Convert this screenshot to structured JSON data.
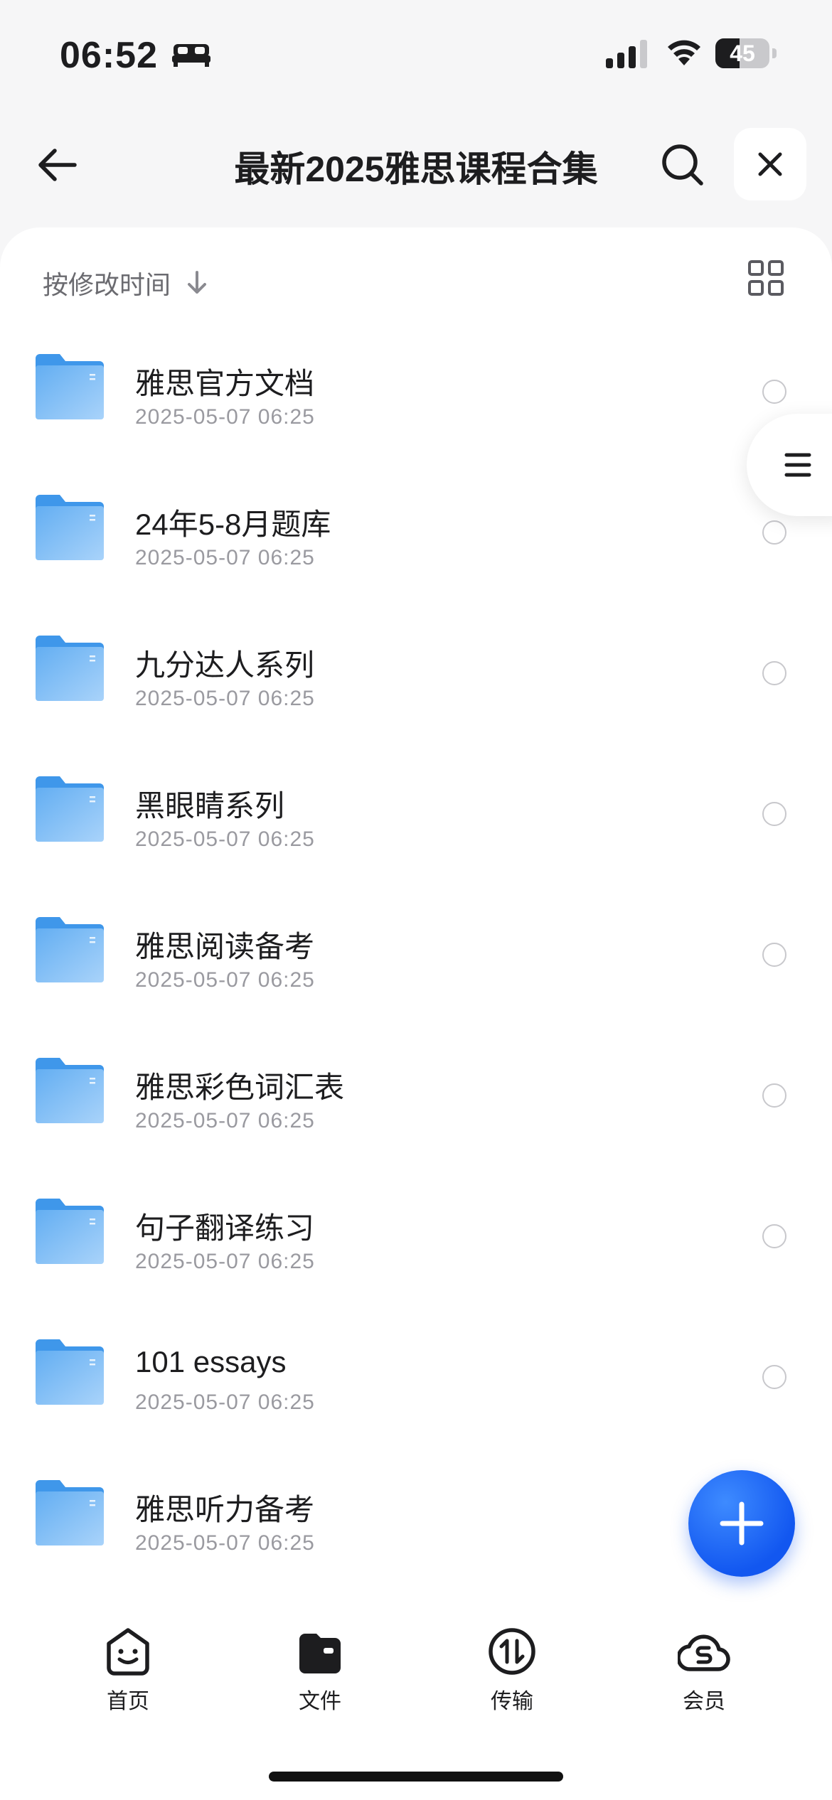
{
  "status": {
    "time": "06:52",
    "battery": "45",
    "battery_level": 0.45
  },
  "header": {
    "title": "最新2025雅思课程合集"
  },
  "sort": {
    "label": "按修改时间"
  },
  "folders": [
    {
      "name": "雅思官方文档",
      "date": "2025-05-07 06:25"
    },
    {
      "name": "24年5-8月题库",
      "date": "2025-05-07 06:25"
    },
    {
      "name": "九分达人系列",
      "date": "2025-05-07 06:25"
    },
    {
      "name": "黑眼睛系列",
      "date": "2025-05-07 06:25"
    },
    {
      "name": "雅思阅读备考",
      "date": "2025-05-07 06:25"
    },
    {
      "name": "雅思彩色词汇表",
      "date": "2025-05-07 06:25"
    },
    {
      "name": "句子翻译练习",
      "date": "2025-05-07 06:25"
    },
    {
      "name": "101 essays",
      "date": "2025-05-07 06:25"
    },
    {
      "name": "雅思听力备考",
      "date": "2025-05-07 06:25"
    }
  ],
  "tabs": [
    {
      "label": "首页",
      "icon": "home-face-icon"
    },
    {
      "label": "文件",
      "icon": "files-wallet-icon"
    },
    {
      "label": "传输",
      "icon": "transfer-icon"
    },
    {
      "label": "会员",
      "icon": "member-cloud-icon"
    }
  ],
  "colors": {
    "accent": "#1257f0",
    "folder": "#5aa9f0"
  }
}
